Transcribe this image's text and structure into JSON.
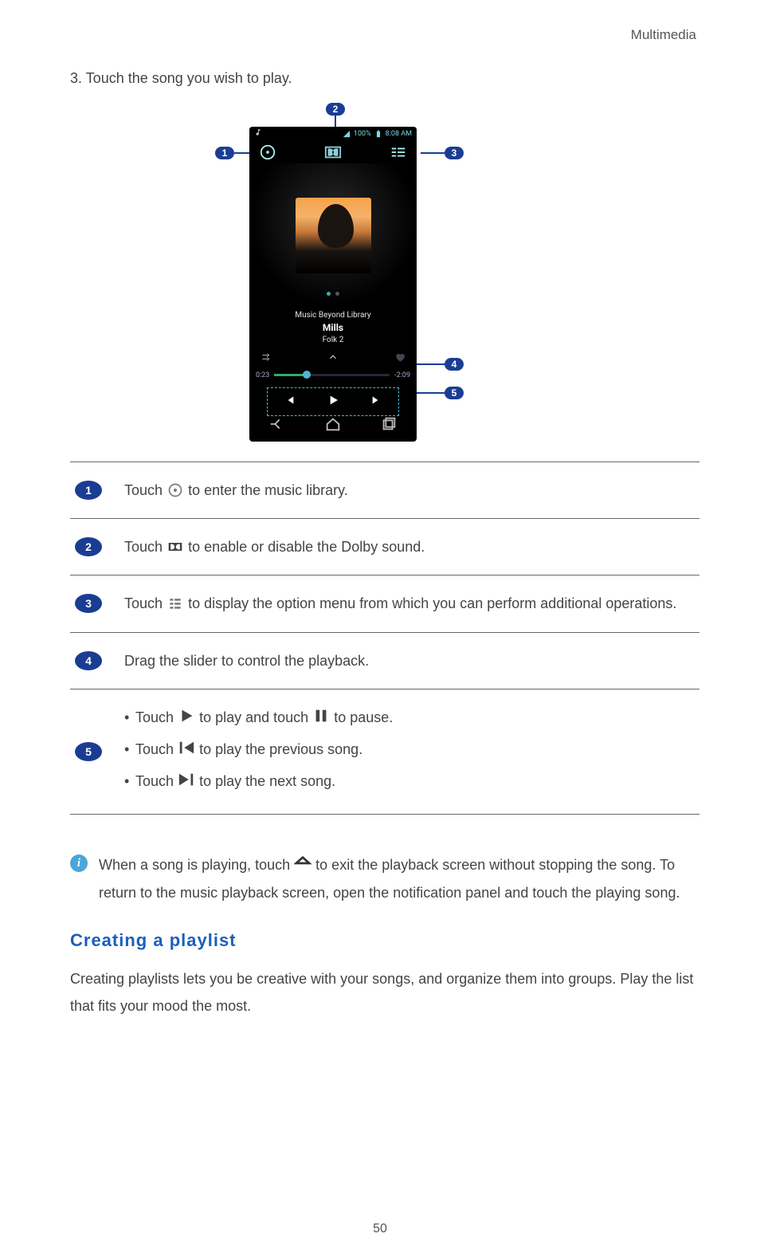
{
  "header_right": "Multimedia",
  "step": {
    "number": "3.",
    "text": "Touch the song you wish to play."
  },
  "screenshot": {
    "status": {
      "battery": "100%",
      "time": "8:08 AM"
    },
    "song": {
      "album": "Music Beyond Library",
      "title": "Mills",
      "artist": "Folk 2"
    },
    "seek": {
      "elapsed": "0:23",
      "remaining": "-2:09"
    }
  },
  "callouts": {
    "c1": "1",
    "c2": "2",
    "c3": "3",
    "c4": "4",
    "c5": "5"
  },
  "legend": {
    "r1": {
      "num": "1",
      "pre": "Touch ",
      "post": " to enter the music library."
    },
    "r2": {
      "num": "2",
      "pre": "Touch ",
      "post": " to enable or disable the Dolby sound."
    },
    "r3": {
      "num": "3",
      "pre": "Touch ",
      "post": " to display the option menu from which you can perform additional operations."
    },
    "r4": {
      "num": "4",
      "text": "Drag the slider to control the playback."
    },
    "r5": {
      "num": "5",
      "line1": {
        "a": "Touch ",
        "b": " to play and touch ",
        "c": " to pause."
      },
      "line2": {
        "a": "Touch ",
        "b": " to play the previous song."
      },
      "line3": {
        "a": "Touch ",
        "b": " to play the next song."
      }
    }
  },
  "info": {
    "a": "When a song is playing, touch ",
    "b": " to exit the playback screen without stopping the song. To return to the music playback screen, open the notification panel and touch the playing song."
  },
  "section_heading": "Creating a playlist",
  "section_body": "Creating playlists lets you be creative with your songs, and organize them into groups. Play the list that fits your mood the most.",
  "page_number": "50"
}
